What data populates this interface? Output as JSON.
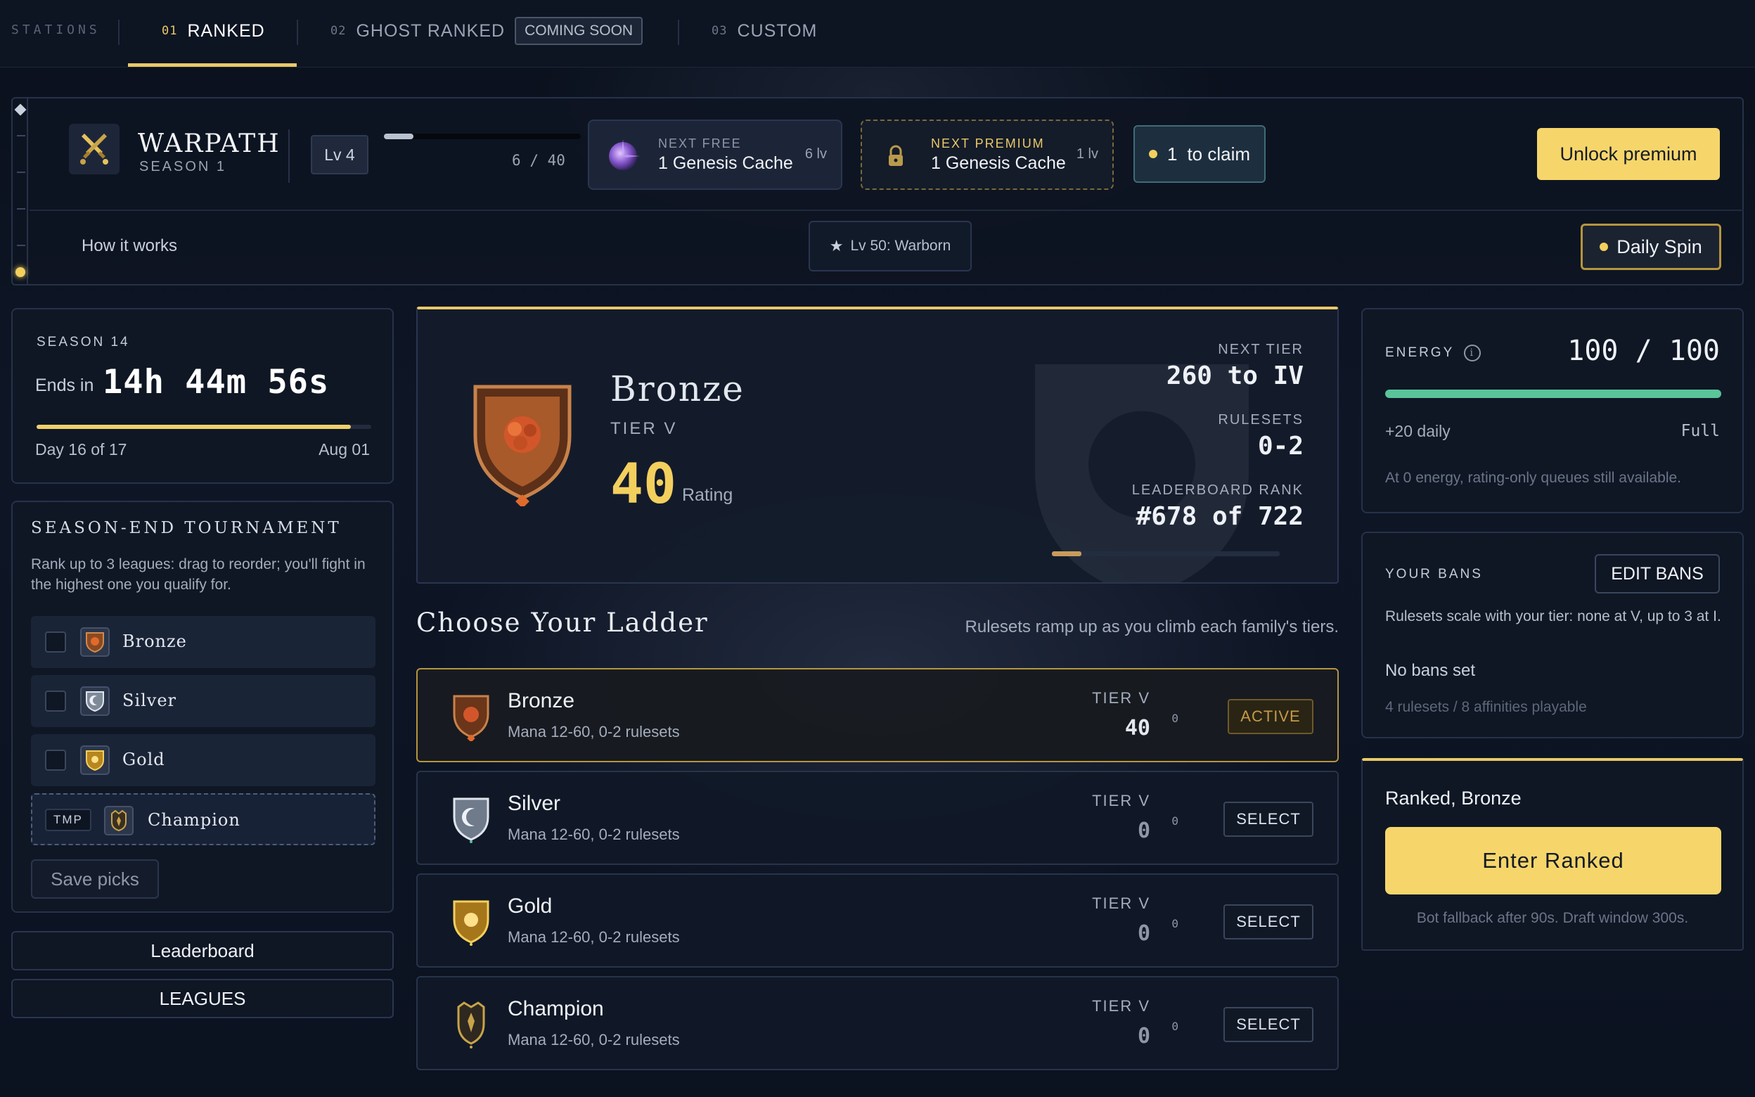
{
  "nav": {
    "section_label": "STATIONS",
    "tabs": [
      {
        "num": "01",
        "label": "RANKED"
      },
      {
        "num": "02",
        "label": "GHOST RANKED",
        "badge": "COMING SOON"
      },
      {
        "num": "03",
        "label": "CUSTOM"
      }
    ],
    "active_tab": "01"
  },
  "battle_pass": {
    "title": "WARPATH",
    "subtitle": "SEASON 1",
    "level": "Lv 4",
    "xp_current": "6",
    "xp_sep": "/",
    "xp_max": "40",
    "xp_progress": 0.15,
    "next_free": {
      "label": "NEXT FREE",
      "reward": "1 Genesis Cache",
      "levels": "6 lv"
    },
    "next_premium": {
      "label": "NEXT PREMIUM",
      "reward": "1 Genesis Cache",
      "levels": "1 lv"
    },
    "claim": {
      "count": "1",
      "label": "to claim"
    },
    "unlock_label": "Unlock premium",
    "how_it_works": "How it works",
    "milestone": "Lv 50: Warborn",
    "daily_spin": "Daily Spin"
  },
  "season": {
    "label": "SEASON 14",
    "ends_prefix": "Ends in",
    "timer": "14h 44m 56s",
    "progress": 0.94,
    "day": "Day 16 of 17",
    "end_date": "Aug 01"
  },
  "tournament": {
    "title": "SEASON-END TOURNAMENT",
    "description": "Rank up to 3 leagues: drag to reorder; you'll fight in the highest one you qualify for.",
    "leagues": [
      {
        "name": "Bronze"
      },
      {
        "name": "Silver"
      },
      {
        "name": "Gold"
      },
      {
        "name": "Champion",
        "badge": "TMP"
      }
    ],
    "save_label": "Save picks"
  },
  "side_buttons": {
    "leaderboard": "Leaderboard",
    "leagues": "LEAGUES"
  },
  "rank": {
    "name": "Bronze",
    "tier": "TIER V",
    "rating": "40",
    "rating_label": "Rating",
    "next_tier_label": "NEXT TIER",
    "next_tier_value": "260 to IV",
    "rulesets_label": "RULESETS",
    "rulesets_value": "0-2",
    "leaderboard_label": "LEADERBOARD RANK",
    "leaderboard_value": "#678 of 722",
    "progress": 0.13
  },
  "ladder": {
    "title": "Choose Your Ladder",
    "hint": "Rulesets ramp up as you climb each family's tiers.",
    "rows": [
      {
        "name": "Bronze",
        "desc": "Mana 12-60, 0-2 rulesets",
        "tier": "TIER V",
        "rating": "40",
        "zero": "0",
        "action": "ACTIVE"
      },
      {
        "name": "Silver",
        "desc": "Mana 12-60, 0-2 rulesets",
        "tier": "TIER V",
        "rating": "0",
        "zero": "0",
        "action": "SELECT"
      },
      {
        "name": "Gold",
        "desc": "Mana 12-60, 0-2 rulesets",
        "tier": "TIER V",
        "rating": "0",
        "zero": "0",
        "action": "SELECT"
      },
      {
        "name": "Champion",
        "desc": "Mana 12-60, 0-2 rulesets",
        "tier": "TIER V",
        "rating": "0",
        "zero": "0",
        "action": "SELECT"
      }
    ]
  },
  "energy": {
    "label": "ENERGY",
    "info_icon": "i",
    "value": "100 / 100",
    "fraction": 1.0,
    "daily": "+20 daily",
    "status": "Full",
    "note": "At 0 energy, rating-only queues still available."
  },
  "bans": {
    "label": "YOUR BANS",
    "edit_label": "EDIT BANS",
    "description": "Rulesets scale with your tier: none at V, up to 3 at I.",
    "status": "No bans set",
    "count": "4 rulesets / 8 affinities playable"
  },
  "enter": {
    "label": "Ranked, Bronze",
    "button": "Enter Ranked",
    "note": "Bot fallback after 90s. Draft window 300s."
  },
  "colors": {
    "accent_gold": "#f6d66b",
    "energy_green": "#5ac49a",
    "bronze": "#c9793d",
    "silver": "#b9c4d2",
    "gold": "#e9b634"
  },
  "icons": {
    "warpath": "crossed-swords-icon",
    "free_reward": "genesis-orb-icon",
    "premium_reward": "lock-icon",
    "milestone": "star-icon",
    "bronze": "bronze-shield-icon",
    "silver": "silver-shield-icon",
    "gold": "gold-shield-icon",
    "champion": "champion-crest-icon"
  }
}
